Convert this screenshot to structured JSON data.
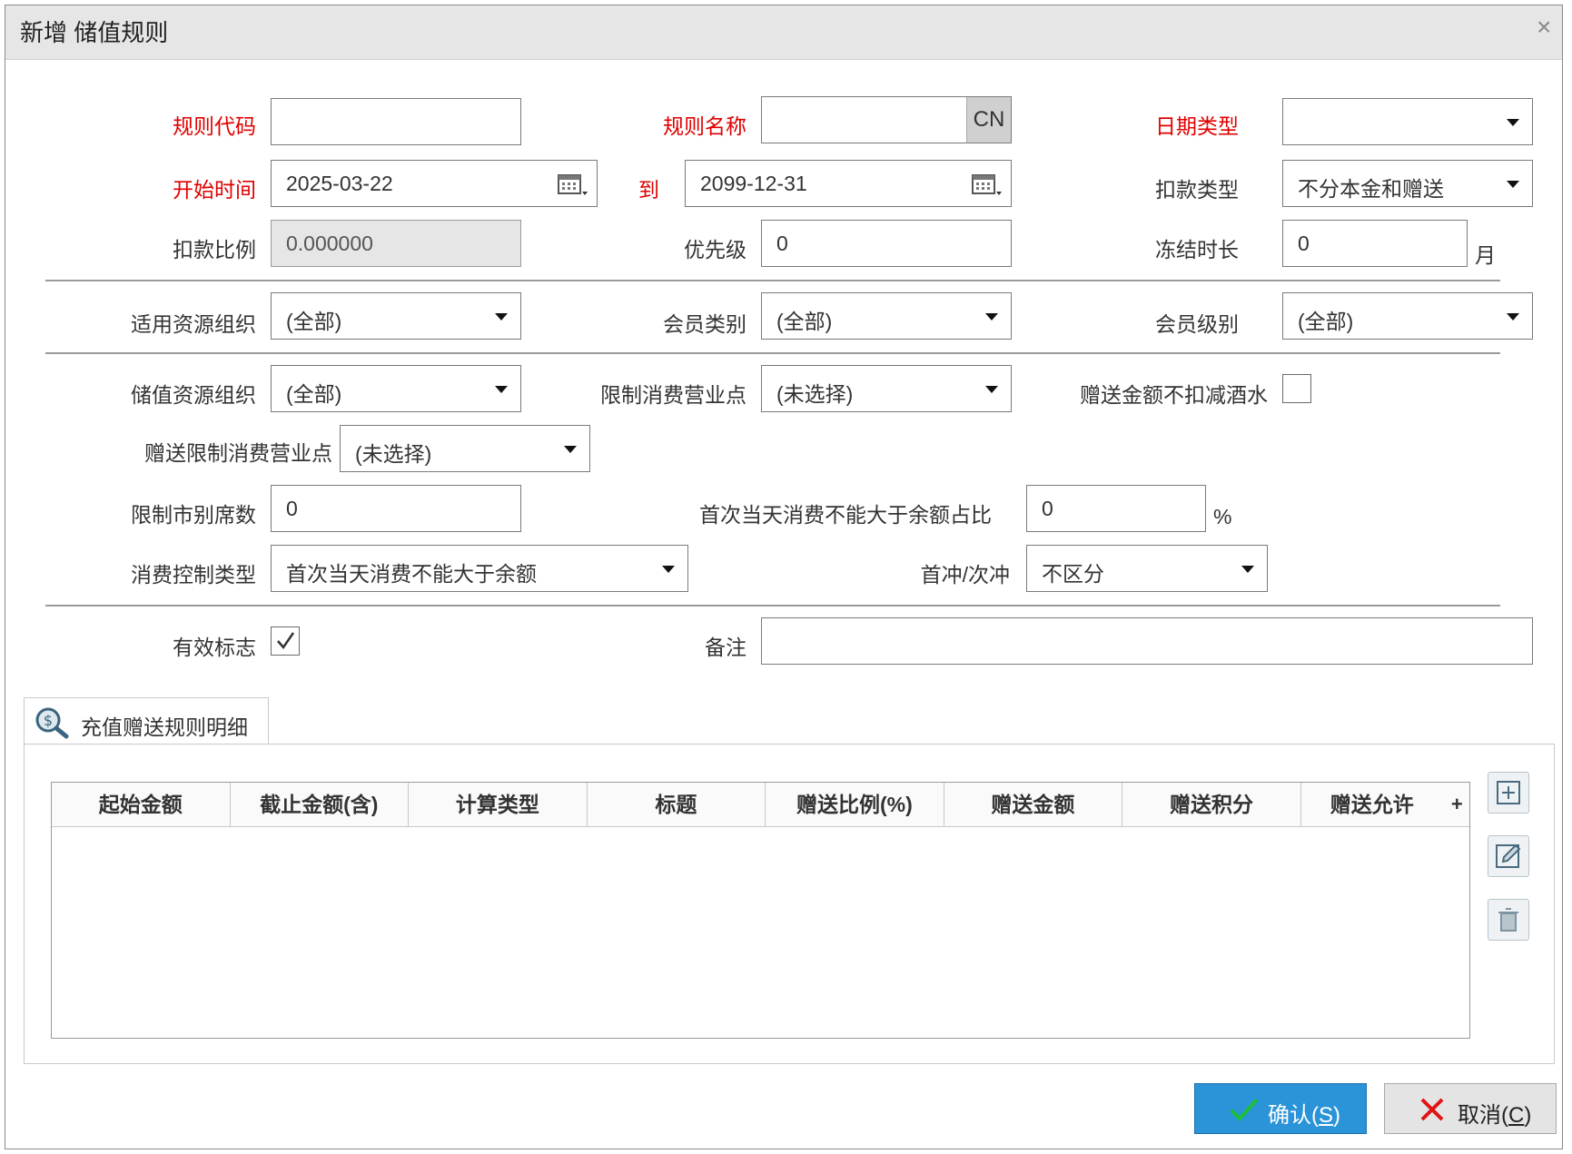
{
  "dialog": {
    "title": "新增 储值规则",
    "close": "×"
  },
  "form": {
    "rule_code": {
      "label": "规则代码",
      "value": ""
    },
    "rule_name": {
      "label": "规则名称",
      "value": "",
      "lang_button": "CN"
    },
    "date_type": {
      "label": "日期类型",
      "value": ""
    },
    "start_time": {
      "label": "开始时间",
      "value": "2025-03-22"
    },
    "to": {
      "label": "到",
      "value": "2099-12-31"
    },
    "deduct_type": {
      "label": "扣款类型",
      "value": "不分本金和赠送"
    },
    "deduct_ratio": {
      "label": "扣款比例",
      "value": "0.000000"
    },
    "priority": {
      "label": "优先级",
      "value": "0"
    },
    "freeze_duration": {
      "label": "冻结时长",
      "value": "0",
      "unit": "月"
    },
    "resource_org": {
      "label": "适用资源组织",
      "value": "(全部)"
    },
    "member_category": {
      "label": "会员类别",
      "value": "(全部)"
    },
    "member_level": {
      "label": "会员级别",
      "value": "(全部)"
    },
    "storage_org": {
      "label": "储值资源组织",
      "value": "(全部)"
    },
    "restrict_outlet": {
      "label": "限制消费营业点",
      "value": "(未选择)"
    },
    "gift_no_deduct_drink": {
      "label": "赠送金额不扣减酒水",
      "checked": false
    },
    "gift_restrict_outlet": {
      "label": "赠送限制消费营业点",
      "value": "(未选择)"
    },
    "restrict_market_seats": {
      "label": "限制市别席数",
      "value": "0"
    },
    "first_day_ratio": {
      "label": "首次当天消费不能大于余额占比",
      "value": "0",
      "unit": "%"
    },
    "consume_control_type": {
      "label": "消费控制类型",
      "value": "首次当天消费不能大于余额"
    },
    "first_charge": {
      "label": "首冲/次冲",
      "value": "不区分"
    },
    "valid_flag": {
      "label": "有效标志",
      "checked": true
    },
    "remark": {
      "label": "备注",
      "value": ""
    }
  },
  "detail": {
    "tab_label": "充值赠送规则明细",
    "columns": [
      "起始金额",
      "截止金额(含)",
      "计算类型",
      "标题",
      "赠送比例(%)",
      "赠送金额",
      "赠送积分",
      "赠送允许"
    ],
    "plus": "+"
  },
  "buttons": {
    "confirm": {
      "text": "确认(",
      "key": "S",
      "end": ")"
    },
    "cancel": {
      "text": "取消(",
      "key": "C",
      "end": ")"
    }
  },
  "colors": {
    "required_label": "#e00000",
    "confirm_bg": "#2b94d8",
    "cancel_bg": "#e4e4e4"
  }
}
